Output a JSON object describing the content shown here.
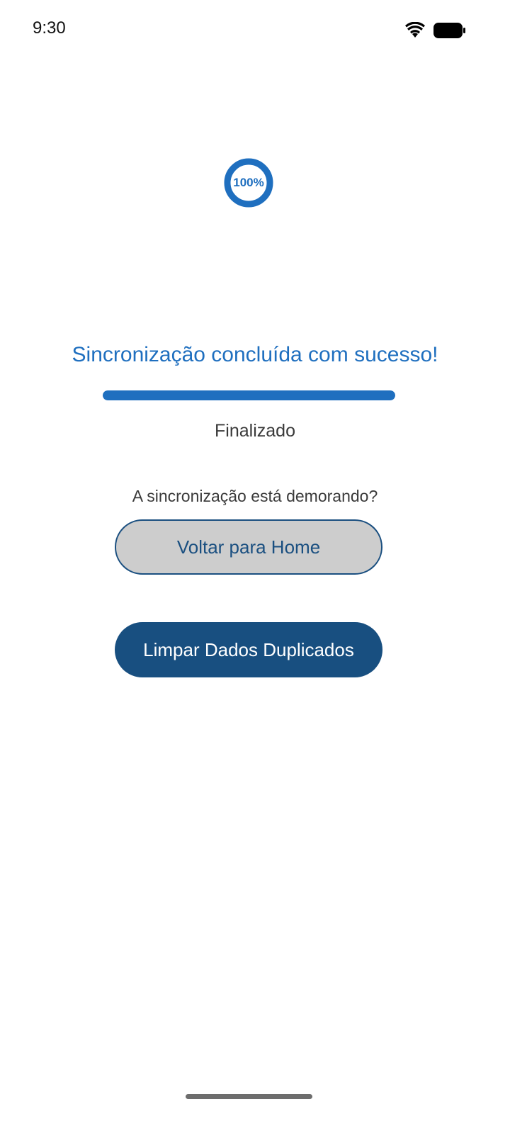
{
  "status_bar": {
    "time": "9:30"
  },
  "sync": {
    "progress_percent": 100,
    "progress_label": "100%",
    "title": "Sincronização concluída com sucesso!",
    "status": "Finalizado",
    "question": "A sincronização está demorando?"
  },
  "buttons": {
    "home_label": "Voltar para Home",
    "clean_label": "Limpar Dados Duplicados"
  },
  "colors": {
    "accent": "#1f6fbf",
    "primary_dark": "#184f80",
    "button_gray": "#cdcdcd"
  }
}
